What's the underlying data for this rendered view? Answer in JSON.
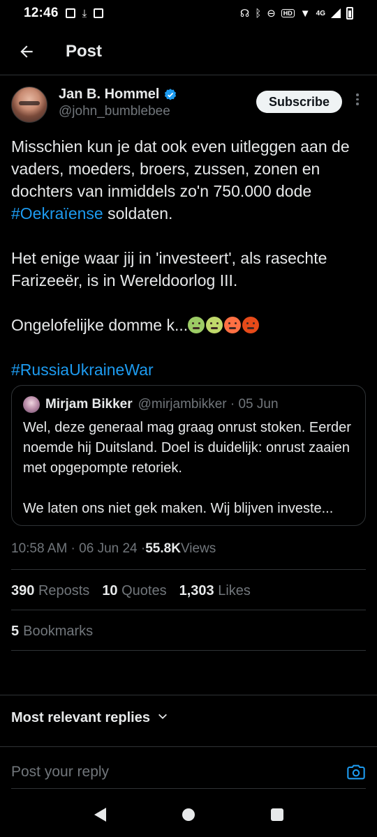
{
  "status_bar": {
    "time": "12:46",
    "network": "4G",
    "hd_badge": "HD"
  },
  "header": {
    "title": "Post"
  },
  "post": {
    "author_name": "Jan B. Hommel",
    "author_handle": "@john_bumblebee",
    "subscribe_label": "Subscribe",
    "text_p1_before": "Misschien kun je dat ook even uitleggen aan de vaders, moeders, broers, zussen, zonen en dochters van inmiddels zo'n 750.000 dode ",
    "text_p1_hashtag": "#Oekraïense",
    "text_p1_after": " soldaten.",
    "text_p2": "Het enige waar jij in 'investeert', als rasechte Farizeeër, is in Wereldoorlog III.",
    "text_p3": "Ongelofelijke domme k...",
    "hashtag": "#RussiaUkraineWar",
    "emojis": [
      "nauseated-face",
      "vomiting-face",
      "angry-face",
      "cursing-face"
    ]
  },
  "quote": {
    "name": "Mirjam Bikker",
    "handle_date": "@mirjambikker · 05 Jun",
    "text_p1": "Wel, deze generaal mag graag onrust stoken. Eerder noemde hij Duitsland. Doel is duidelijk: onrust zaaien met opgepompte retoriek.",
    "text_p2": "We laten ons niet gek maken. Wij blijven investe..."
  },
  "meta": {
    "time_date": "10:58 AM · 06 Jun 24 · ",
    "views_count": "55.8K",
    "views_label": " Views"
  },
  "stats": {
    "reposts_count": "390",
    "reposts_label": "Reposts",
    "quotes_count": "10",
    "quotes_label": "Quotes",
    "likes_count": "1,303",
    "likes_label": "Likes",
    "bookmarks_count": "5",
    "bookmarks_label": "Bookmarks"
  },
  "replies": {
    "sort_label": "Most relevant replies",
    "reply_placeholder": "Post your reply"
  },
  "colors": {
    "accent": "#1d9bf0",
    "background": "#000000",
    "muted": "#71767b",
    "text": "#e7e9ea"
  }
}
